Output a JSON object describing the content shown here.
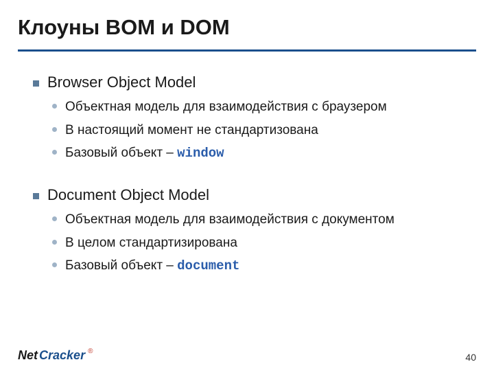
{
  "title": "Клоуны BOM и DOM",
  "sections": [
    {
      "heading": "Browser Object Model",
      "items": [
        {
          "text": "Объектная модель для взаимодействия с браузером",
          "code": null
        },
        {
          "text": "В настоящий момент не стандартизована",
          "code": null
        },
        {
          "text": "Базовый объект – ",
          "code": "window"
        }
      ]
    },
    {
      "heading": "Document Object Model",
      "items": [
        {
          "text": "Объектная модель для взаимодействия с документом",
          "code": null
        },
        {
          "text": "В целом стандартизирована",
          "code": null
        },
        {
          "text": "Базовый объект – ",
          "code": "document"
        }
      ]
    }
  ],
  "footer": {
    "logo_net": "Net",
    "logo_cracker": "Cracker",
    "logo_mark": "®"
  },
  "page_number": "40"
}
